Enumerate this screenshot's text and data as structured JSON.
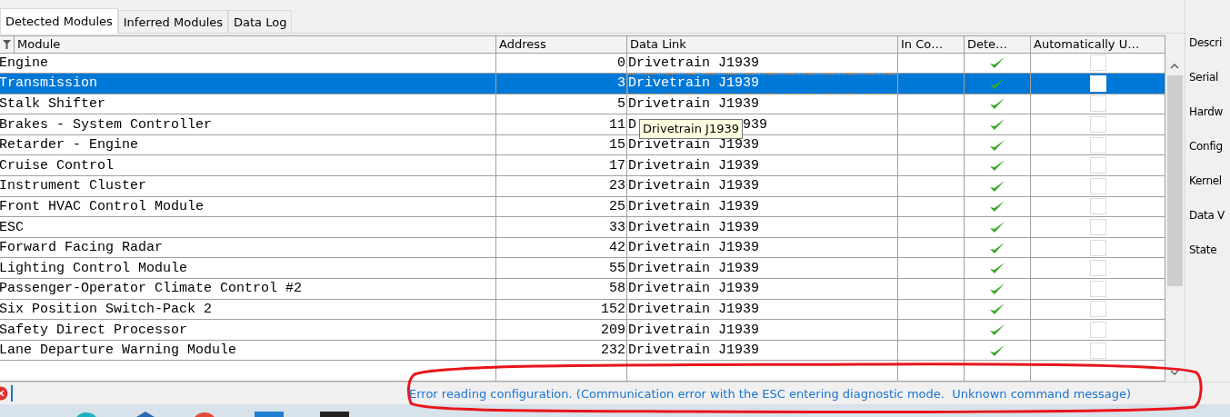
{
  "tabs": [
    {
      "label": "Detected Modules",
      "selected": true
    },
    {
      "label": "Inferred Modules",
      "selected": false
    },
    {
      "label": "Data Log",
      "selected": false
    }
  ],
  "table": {
    "columns": [
      "Module",
      "Address",
      "Data Link",
      "In Co…",
      "Dete…",
      "Automatically U…"
    ],
    "rows": [
      {
        "module": "Engine",
        "address": "0",
        "data_link": "Drivetrain J1939",
        "detected": true,
        "auto": false,
        "selected": false
      },
      {
        "module": "Transmission",
        "address": "3",
        "data_link": "Drivetrain J1939",
        "detected": true,
        "auto": false,
        "selected": true
      },
      {
        "module": "Stalk Shifter",
        "address": "5",
        "data_link": "Drivetrain J1939",
        "detected": true,
        "auto": false,
        "selected": false
      },
      {
        "module": "Brakes - System Controller",
        "address": "11",
        "data_link_parts": [
          "D",
          "939"
        ],
        "detected": true,
        "auto": false,
        "selected": false
      },
      {
        "module": "Retarder - Engine",
        "address": "15",
        "data_link": "Drivetrain J1939",
        "detected": true,
        "auto": false,
        "selected": false
      },
      {
        "module": "Cruise Control",
        "address": "17",
        "data_link": "Drivetrain J1939",
        "detected": true,
        "auto": false,
        "selected": false
      },
      {
        "module": "Instrument Cluster",
        "address": "23",
        "data_link": "Drivetrain J1939",
        "detected": true,
        "auto": false,
        "selected": false
      },
      {
        "module": "Front HVAC Control Module",
        "address": "25",
        "data_link": "Drivetrain J1939",
        "detected": true,
        "auto": false,
        "selected": false
      },
      {
        "module": "ESC",
        "address": "33",
        "data_link": "Drivetrain J1939",
        "detected": true,
        "auto": false,
        "selected": false
      },
      {
        "module": "Forward Facing Radar",
        "address": "42",
        "data_link": "Drivetrain J1939",
        "detected": true,
        "auto": false,
        "selected": false
      },
      {
        "module": "Lighting Control Module",
        "address": "55",
        "data_link": "Drivetrain J1939",
        "detected": true,
        "auto": false,
        "selected": false
      },
      {
        "module": "Passenger-Operator Climate Control #2",
        "address": "58",
        "data_link": "Drivetrain J1939",
        "detected": true,
        "auto": false,
        "selected": false
      },
      {
        "module": "Six Position Switch-Pack 2",
        "address": "152",
        "data_link": "Drivetrain J1939",
        "detected": true,
        "auto": false,
        "selected": false
      },
      {
        "module": "Safety Direct Processor",
        "address": "209",
        "data_link": "Drivetrain J1939",
        "detected": true,
        "auto": false,
        "selected": false
      },
      {
        "module": "Lane Departure Warning Module",
        "address": "232",
        "data_link": "Drivetrain J1939",
        "detected": true,
        "auto": false,
        "selected": false
      }
    ]
  },
  "tooltip": "Drivetrain J1939",
  "details_labels": [
    "Descri",
    "Serial",
    "Hardw",
    "Config",
    "Kernel",
    "Data V",
    "State"
  ],
  "status_bar": {
    "message": "Error reading configuration. (Communication error with the ESC entering diagnostic mode.  Unknown command message)"
  }
}
